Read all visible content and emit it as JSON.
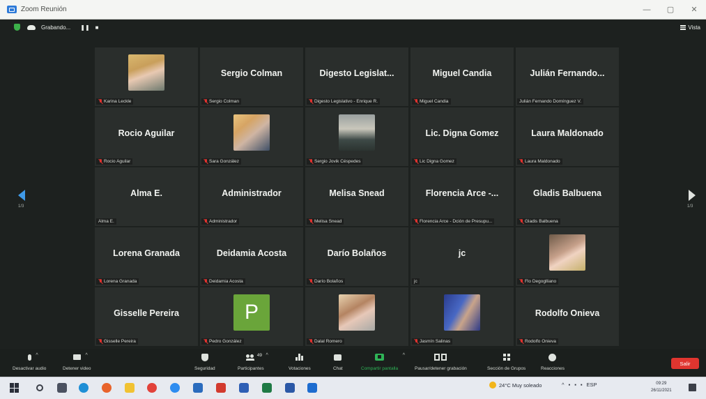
{
  "window": {
    "title": "Zoom Reunión"
  },
  "topbar": {
    "recording_label": "Grabando...",
    "pause_glyph": "❚❚",
    "stop_glyph": "■",
    "view_label": "Vista"
  },
  "gallery": {
    "page_left": "1/3",
    "page_right": "1/3",
    "tiles": [
      {
        "big_name": "",
        "label": "Karina Leckle",
        "photo": "karina"
      },
      {
        "big_name": "Sergio Colman",
        "label": "Sergio Colman"
      },
      {
        "big_name": "Digesto  Legislat...",
        "label": "Digesto Legislativo - Enrique R."
      },
      {
        "big_name": "Miguel Candia",
        "label": "Miguel Candia"
      },
      {
        "big_name": "Julián  Fernando...",
        "label": "Julián Fernando Domínguez V.",
        "unmuted": true
      },
      {
        "big_name": "Rocio Aguilar",
        "label": "Rocio Aguilar"
      },
      {
        "big_name": "",
        "label": "Sara González",
        "photo": "sara"
      },
      {
        "big_name": "",
        "label": "Sergio Jovik Céspedes",
        "photo": "sergio"
      },
      {
        "big_name": "Lic. Digna Gomez",
        "label": "Lic Digna Gomez"
      },
      {
        "big_name": "Laura Maldonado",
        "label": "Laura Maldonado"
      },
      {
        "big_name": "Alma E.",
        "label": "Alma E.",
        "unmuted": true
      },
      {
        "big_name": "Administrador",
        "label": "Administrador"
      },
      {
        "big_name": "Melisa Snead",
        "label": "Melisa Snead"
      },
      {
        "big_name": "Florencia Arce -...",
        "label": "Florencia Arce - Dción de Presupu..."
      },
      {
        "big_name": "Gladis Balbuena",
        "label": "Gladis Balbuena"
      },
      {
        "big_name": "Lorena Granada",
        "label": "Lorena Granada"
      },
      {
        "big_name": "Deidamia Acosta",
        "label": "Deidamia Acosta"
      },
      {
        "big_name": "Darío Bolaños",
        "label": "Darío Bolaños"
      },
      {
        "big_name": "jc",
        "label": "jc",
        "unmuted": true
      },
      {
        "big_name": "",
        "label": "Flo Degoglliano",
        "photo": "flo"
      },
      {
        "big_name": "Gisselle Pereira",
        "label": "Gisselle Pereira"
      },
      {
        "big_name": "",
        "label": "Pedro González",
        "avatar_letter": "P"
      },
      {
        "big_name": "",
        "label": "Dalal Romero",
        "photo": "dalal"
      },
      {
        "big_name": "",
        "label": "Jasmín Salinas",
        "photo": "jasmin"
      },
      {
        "big_name": "Rodolfo Onieva",
        "label": "Rodolfo Onieva"
      }
    ]
  },
  "toolbar": {
    "audio_label": "Desactivar audio",
    "video_label": "Detener video",
    "security_label": "Seguridad",
    "participants_label": "Participantes",
    "participants_count": "49",
    "polls_label": "Votaciones",
    "chat_label": "Chat",
    "share_label": "Compartir pantalla",
    "record_label": "Pausar/detener grabación",
    "breakout_label": "Sección de Grupos",
    "reactions_label": "Reacciones",
    "leave_label": "Salir"
  },
  "taskbar": {
    "weather": "24°C  Muy soleado",
    "lang": "ESP",
    "time": "09:29",
    "date": "26/11/2021"
  },
  "colors": {
    "accent": "#3f9ae8",
    "muted": "#e0332f",
    "share": "#2fb457",
    "leave": "#e0352f",
    "avatar": "#6aa53a"
  }
}
